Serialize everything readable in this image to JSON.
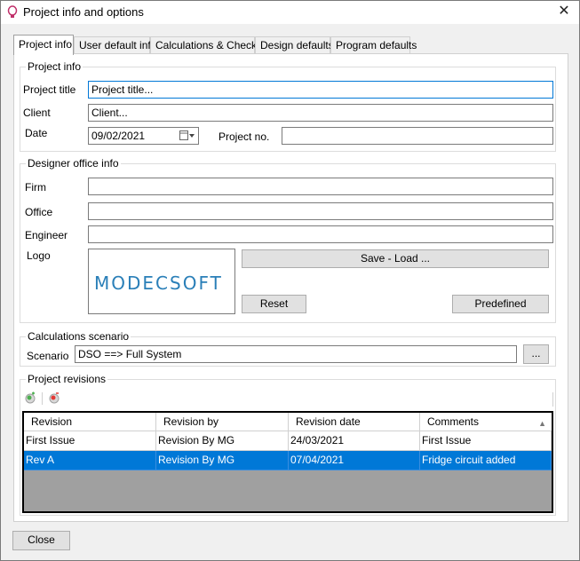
{
  "window": {
    "title": "Project info and options",
    "icon": "lightbulb-icon"
  },
  "tabs": [
    {
      "label": "Project info",
      "active": true
    },
    {
      "label": "User default info"
    },
    {
      "label": "Calculations & Checks"
    },
    {
      "label": "Design defaults"
    },
    {
      "label": "Program defaults"
    }
  ],
  "project_info": {
    "legend": "Project info",
    "title_label": "Project title",
    "title_value": "Project title...",
    "client_label": "Client",
    "client_value": "Client...",
    "date_label": "Date",
    "date_value": "09/02/2021",
    "project_no_label": "Project no.",
    "project_no_value": ""
  },
  "designer": {
    "legend": "Designer office info",
    "firm_label": "Firm",
    "office_label": "Office",
    "engineer_label": "Engineer",
    "logo_label": "Logo",
    "logo_text": "MODECSOFT",
    "save_load": "Save - Load ...",
    "reset": "Reset",
    "predefined": "Predefined"
  },
  "scenario": {
    "legend": "Calculations scenario",
    "label": "Scenario",
    "value": "DSO ==> Full System",
    "browse": "..."
  },
  "revisions": {
    "legend": "Project revisions",
    "columns": [
      "Revision",
      "Revision by",
      "Revision date",
      "Comments"
    ],
    "rows": [
      [
        "First Issue",
        "Revision By MG",
        "24/03/2021",
        "First Issue"
      ],
      [
        "Rev A",
        "Revision By MG",
        "07/04/2021",
        "Fridge circuit added"
      ]
    ]
  },
  "footer": {
    "close": "Close"
  },
  "colors": {
    "selection": "#0078d7",
    "focus_border": "#0078d7"
  }
}
